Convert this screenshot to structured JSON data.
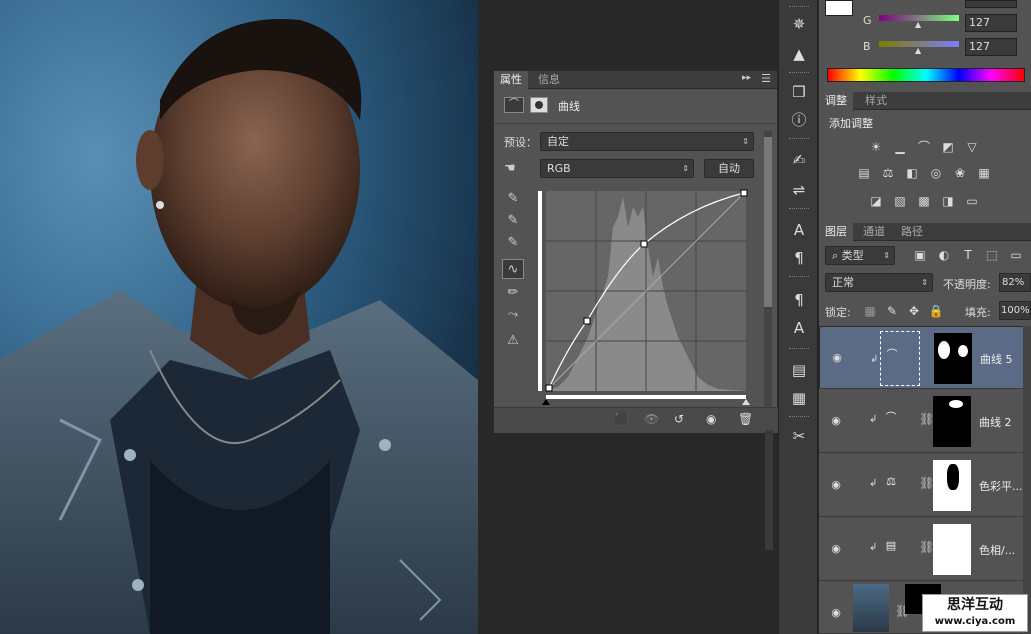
{
  "colors": {
    "accent": "#5c6b85",
    "panel": "#535353",
    "canvas": "#282828"
  },
  "color_panel": {
    "g_label": "G",
    "g_value": "127",
    "b_label": "B",
    "b_value": "127"
  },
  "properties": {
    "tabs": [
      "属性",
      "信息"
    ],
    "title": "曲线",
    "preset_label": "预设：",
    "preset_value": "自定",
    "channel_value": "RGB",
    "auto_button": "自动"
  },
  "adjustments": {
    "tabs": [
      "调整",
      "样式"
    ],
    "add_label": "添加调整"
  },
  "layers": {
    "tabs": [
      "图层",
      "通道",
      "路径"
    ],
    "filter_label": "类型",
    "blend_mode": "正常",
    "opacity_label": "不透明度:",
    "opacity_value": "82%",
    "lock_label": "锁定:",
    "fill_label": "填充:",
    "fill_value": "100%",
    "items": [
      {
        "name": "曲线 5"
      },
      {
        "name": "曲线 2"
      },
      {
        "name": "色彩平..."
      },
      {
        "name": "色相/..."
      },
      {
        "name": ""
      }
    ]
  },
  "watermark": {
    "line1": "思洋互动",
    "line2": "www.ciya.com"
  }
}
